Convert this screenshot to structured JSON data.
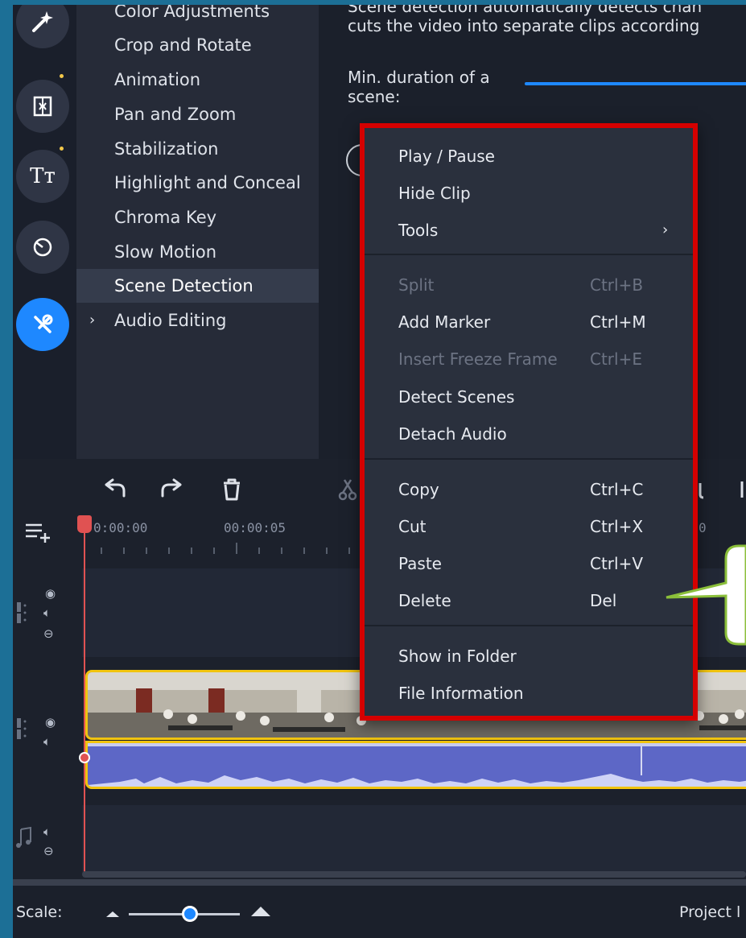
{
  "sidebar": {
    "tools": [
      {
        "label": "Color Adjustments"
      },
      {
        "label": "Crop and Rotate"
      },
      {
        "label": "Animation"
      },
      {
        "label": "Pan and Zoom"
      },
      {
        "label": "Stabilization"
      },
      {
        "label": "Highlight and Conceal"
      },
      {
        "label": "Chroma Key"
      },
      {
        "label": "Slow Motion"
      },
      {
        "label": "Scene Detection",
        "selected": true
      },
      {
        "label": "Audio Editing",
        "expandable": true
      }
    ],
    "rail_icons": [
      "magic-wand-icon",
      "transitions-icon",
      "titles-icon",
      "stickers-icon",
      "tools-icon"
    ]
  },
  "settings": {
    "desc_line1": "Scene detection automatically detects chan",
    "desc_line2": "cuts the video into separate clips according",
    "min_duration_line1": "Min. duration of a",
    "min_duration_line2": "scene:"
  },
  "timeline": {
    "toolbar_icons": [
      "undo-icon",
      "redo-icon",
      "delete-icon",
      "scissors-icon"
    ],
    "ruler_labels": [
      "0:00:00",
      "00:00:05",
      "0"
    ]
  },
  "context_menu": {
    "groups": [
      [
        {
          "label": "Play / Pause"
        },
        {
          "label": "Hide Clip"
        },
        {
          "label": "Tools",
          "submenu": true
        }
      ],
      [
        {
          "label": "Split",
          "shortcut": "Ctrl+B",
          "disabled": true
        },
        {
          "label": "Add Marker",
          "shortcut": "Ctrl+M"
        },
        {
          "label": "Insert Freeze Frame",
          "shortcut": "Ctrl+E",
          "disabled": true
        },
        {
          "label": "Detect Scenes"
        },
        {
          "label": "Detach Audio"
        }
      ],
      [
        {
          "label": "Copy",
          "shortcut": "Ctrl+C"
        },
        {
          "label": "Cut",
          "shortcut": "Ctrl+X"
        },
        {
          "label": "Paste",
          "shortcut": "Ctrl+V"
        },
        {
          "label": "Delete",
          "shortcut": "Del"
        }
      ],
      [
        {
          "label": "Show in Folder"
        },
        {
          "label": "File Information"
        }
      ]
    ],
    "highlight_color": "#d50000"
  },
  "bottom_bar": {
    "scale_label": "Scale:",
    "project_label": "Project l",
    "scale_value": 0.55
  },
  "colors": {
    "accent": "#1e88ff",
    "clip_border": "#f1c40f",
    "playhead": "#e05252",
    "frame": "#1c6f96"
  }
}
